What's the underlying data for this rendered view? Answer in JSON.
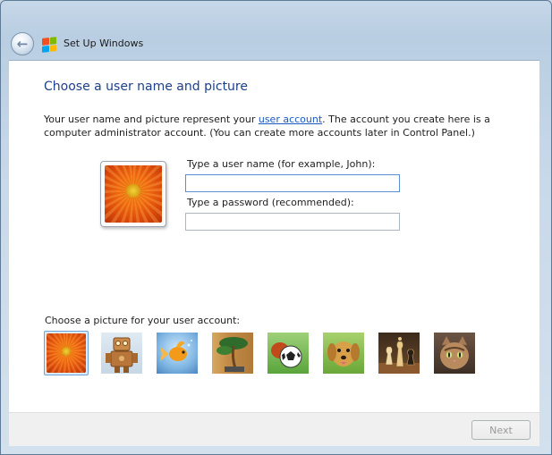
{
  "window": {
    "title": "Set Up Windows",
    "accent": "#1e3f8a"
  },
  "main": {
    "heading": "Choose a user name and picture",
    "intro_before": "Your user name and picture represent your ",
    "intro_link": "user account",
    "intro_after": ". The account you create here is a computer administrator account. (You can create more accounts later in Control Panel.)"
  },
  "form": {
    "username_label": "Type a user name (for example, John):",
    "username_value": "",
    "password_label": "Type a password (recommended):",
    "password_value": ""
  },
  "pictures": {
    "label": "Choose a picture for your user account:",
    "selected": "flower",
    "items": [
      "flower",
      "robot",
      "goldfish",
      "bonsai",
      "soccer-ball",
      "puppy",
      "chess",
      "kitten"
    ]
  },
  "footer": {
    "next_label": "Next",
    "next_enabled": false
  },
  "icons": {
    "back": "back-arrow-icon",
    "windows_logo": "windows-logo-icon"
  }
}
